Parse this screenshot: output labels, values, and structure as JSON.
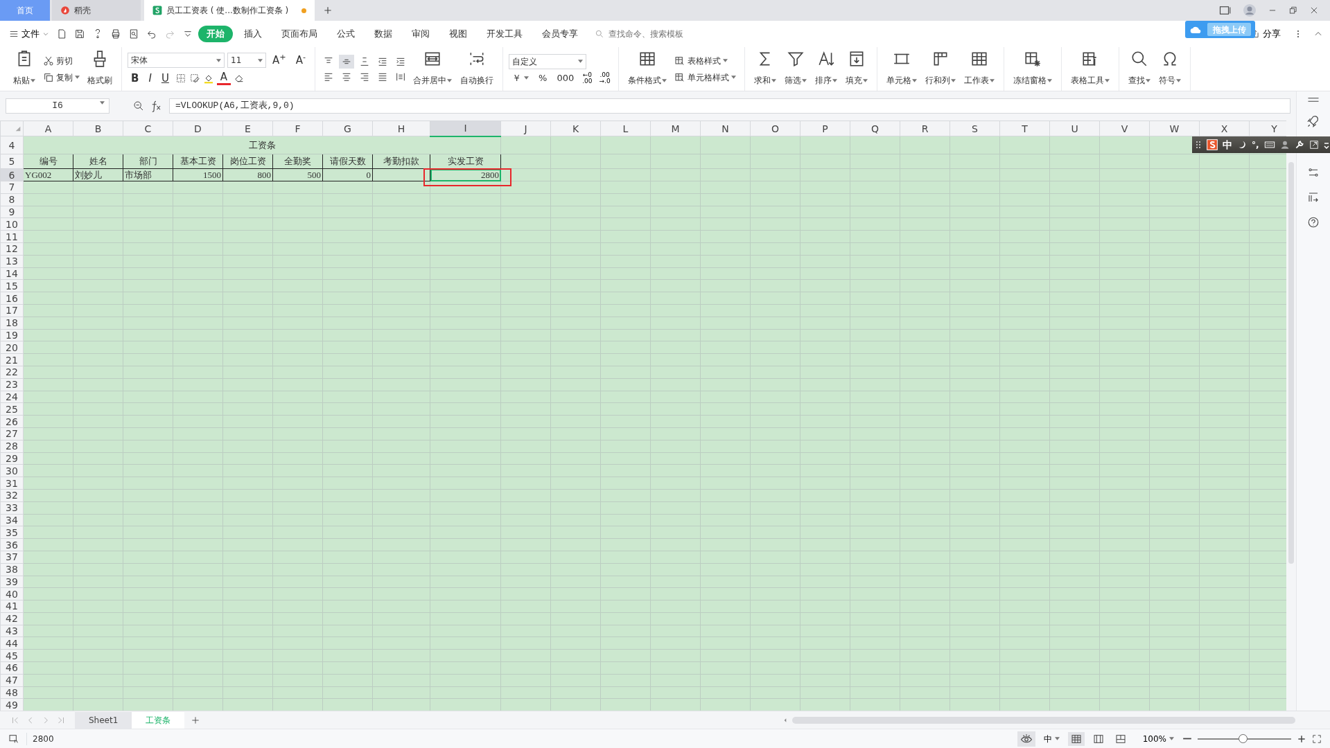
{
  "title_tabs": [
    {
      "label": "首页",
      "kind": "home",
      "selected": false,
      "modified": false
    },
    {
      "label": "稻壳",
      "kind": "app",
      "selected": false,
      "modified": false
    },
    {
      "label": "员工工资表 ( 使...数制作工资条 )",
      "kind": "doc",
      "selected": true,
      "modified": true
    }
  ],
  "file_menu": "文件",
  "menu_tabs": [
    {
      "label": "开始",
      "selected": true
    },
    {
      "label": "插入",
      "selected": false
    },
    {
      "label": "页面布局",
      "selected": false
    },
    {
      "label": "公式",
      "selected": false
    },
    {
      "label": "数据",
      "selected": false
    },
    {
      "label": "审阅",
      "selected": false
    },
    {
      "label": "视图",
      "selected": false
    },
    {
      "label": "开发工具",
      "selected": false
    },
    {
      "label": "会员专享",
      "selected": false
    }
  ],
  "search": {
    "placeholder": "查找命令、搜索模板"
  },
  "upload_popup": "拖拽上传",
  "share": "分享",
  "ribbon": {
    "clipboard": [
      {
        "label": "粘贴",
        "kind": "large",
        "dropdown": true
      },
      {
        "label": "剪切",
        "kind": "small",
        "dropdown": false
      },
      {
        "label": "复制",
        "kind": "small",
        "dropdown": true
      },
      {
        "label": "格式刷",
        "kind": "large",
        "dropdown": false
      }
    ],
    "font": {
      "name": "宋体",
      "size": "11",
      "size_buttons": [
        "A$^{+}$",
        "A$^{-}$"
      ],
      "style_buttons": [
        "B",
        "I",
        "U"
      ],
      "color_button": "A"
    },
    "alignment": [
      {
        "label": "合并居中",
        "dropdown": true
      },
      {
        "label": "自动换行",
        "dropdown": false
      }
    ],
    "number": {
      "format": "自定义",
      "symbols": [
        "￥",
        "%",
        "000"
      ],
      "decimal_buttons": [
        {
          "top": "←0",
          "bottom": ".00"
        },
        {
          "top": ".00",
          "bottom": "→.0"
        }
      ]
    },
    "styles": [
      {
        "label": "条件格式",
        "kind": "large",
        "dropdown": true
      },
      {
        "label": "表格样式",
        "kind": "small",
        "dropdown": true
      },
      {
        "label": "单元格样式",
        "kind": "small",
        "dropdown": true
      }
    ],
    "groups": [
      [
        {
          "label": "求和",
          "dropdown": true
        },
        {
          "label": "筛选",
          "dropdown": true
        },
        {
          "label": "排序",
          "dropdown": true
        },
        {
          "label": "填充",
          "dropdown": true
        }
      ],
      [
        {
          "label": "单元格",
          "dropdown": true
        },
        {
          "label": "行和列",
          "dropdown": true
        },
        {
          "label": "工作表",
          "dropdown": true
        }
      ],
      [
        {
          "label": "冻结窗格",
          "dropdown": true
        }
      ],
      [
        {
          "label": "表格工具",
          "dropdown": true
        }
      ],
      [
        {
          "label": "查找",
          "dropdown": true
        },
        {
          "label": "符号",
          "dropdown": true
        }
      ]
    ]
  },
  "name_box": "I6",
  "formula": "=VLOOKUP(A6,工资表,9,0)",
  "columns": [
    {
      "label": "A",
      "selected": false
    },
    {
      "label": "B",
      "selected": false
    },
    {
      "label": "C",
      "selected": false
    },
    {
      "label": "D",
      "selected": false
    },
    {
      "label": "E",
      "selected": false
    },
    {
      "label": "F",
      "selected": false
    },
    {
      "label": "G",
      "selected": false
    },
    {
      "label": "H",
      "selected": false
    },
    {
      "label": "I",
      "selected": true
    },
    {
      "label": "J",
      "selected": false
    },
    {
      "label": "K",
      "selected": false
    },
    {
      "label": "L",
      "selected": false
    },
    {
      "label": "M",
      "selected": false
    },
    {
      "label": "N",
      "selected": false
    },
    {
      "label": "O",
      "selected": false
    },
    {
      "label": "P",
      "selected": false
    },
    {
      "label": "Q",
      "selected": false
    },
    {
      "label": "R",
      "selected": false
    },
    {
      "label": "S",
      "selected": false
    },
    {
      "label": "T",
      "selected": false
    },
    {
      "label": "U",
      "selected": false
    },
    {
      "label": "V",
      "selected": false
    },
    {
      "label": "W",
      "selected": false
    },
    {
      "label": "X",
      "selected": false
    },
    {
      "label": "Y",
      "selected": false
    }
  ],
  "rows": [
    {
      "label": "4",
      "selected": false,
      "cells": [
        {
          "text": "工资条",
          "kind": "title",
          "selected": false,
          "annotated": false
        }
      ]
    },
    {
      "label": "5",
      "selected": false,
      "cells": [
        {
          "text": "编号",
          "kind": "header",
          "selected": false,
          "annotated": false
        },
        {
          "text": "姓名",
          "kind": "header",
          "selected": false,
          "annotated": false
        },
        {
          "text": "部门",
          "kind": "header",
          "selected": false,
          "annotated": false
        },
        {
          "text": "基本工资",
          "kind": "header",
          "selected": false,
          "annotated": false
        },
        {
          "text": "岗位工资",
          "kind": "header",
          "selected": false,
          "annotated": false
        },
        {
          "text": "全勤奖",
          "kind": "header",
          "selected": false,
          "annotated": false
        },
        {
          "text": "请假天数",
          "kind": "header",
          "selected": false,
          "annotated": false
        },
        {
          "text": "考勤扣款",
          "kind": "header",
          "selected": false,
          "annotated": false
        },
        {
          "text": "实发工资",
          "kind": "header",
          "selected": false,
          "annotated": false
        }
      ]
    },
    {
      "label": "6",
      "selected": true,
      "cells": [
        {
          "text": "YG002",
          "kind": "text",
          "selected": false,
          "annotated": false
        },
        {
          "text": "刘妙儿",
          "kind": "text",
          "selected": false,
          "annotated": false
        },
        {
          "text": "市场部",
          "kind": "text",
          "selected": false,
          "annotated": false
        },
        {
          "text": "1500",
          "kind": "number",
          "selected": false,
          "annotated": false
        },
        {
          "text": "800",
          "kind": "number",
          "selected": false,
          "annotated": false
        },
        {
          "text": "500",
          "kind": "number",
          "selected": false,
          "annotated": false
        },
        {
          "text": "0",
          "kind": "number",
          "selected": false,
          "annotated": false
        },
        {
          "kind": "number",
          "selected": false,
          "annotated": false
        },
        {
          "text": "2800",
          "kind": "number",
          "selected": true,
          "annotated": true
        }
      ]
    },
    {
      "label": "7",
      "selected": false
    },
    {
      "label": "8",
      "selected": false
    },
    {
      "label": "9",
      "selected": false
    },
    {
      "label": "10",
      "selected": false
    },
    {
      "label": "11",
      "selected": false
    },
    {
      "label": "12",
      "selected": false
    },
    {
      "label": "13",
      "selected": false
    },
    {
      "label": "14",
      "selected": false
    },
    {
      "label": "15",
      "selected": false
    },
    {
      "label": "16",
      "selected": false
    },
    {
      "label": "17",
      "selected": false
    },
    {
      "label": "18",
      "selected": false
    },
    {
      "label": "19",
      "selected": false
    },
    {
      "label": "20",
      "selected": false
    },
    {
      "label": "21",
      "selected": false
    },
    {
      "label": "22",
      "selected": false
    },
    {
      "label": "23",
      "selected": false
    },
    {
      "label": "24",
      "selected": false
    },
    {
      "label": "25",
      "selected": false
    },
    {
      "label": "26",
      "selected": false
    },
    {
      "label": "27",
      "selected": false
    },
    {
      "label": "28",
      "selected": false
    },
    {
      "label": "29",
      "selected": false
    },
    {
      "label": "30",
      "selected": false
    },
    {
      "label": "31",
      "selected": false
    },
    {
      "label": "32",
      "selected": false
    },
    {
      "label": "33",
      "selected": false
    },
    {
      "label": "34",
      "selected": false
    },
    {
      "label": "35",
      "selected": false
    },
    {
      "label": "36",
      "selected": false
    },
    {
      "label": "37",
      "selected": false
    },
    {
      "label": "38",
      "selected": false
    },
    {
      "label": "39",
      "selected": false
    },
    {
      "label": "40",
      "selected": false
    },
    {
      "label": "41",
      "selected": false
    },
    {
      "label": "42",
      "selected": false
    },
    {
      "label": "43",
      "selected": false
    },
    {
      "label": "44",
      "selected": false
    },
    {
      "label": "45",
      "selected": false
    },
    {
      "label": "46",
      "selected": false
    },
    {
      "label": "47",
      "selected": false
    },
    {
      "label": "48",
      "selected": false
    },
    {
      "label": "49",
      "selected": false
    }
  ],
  "sheet_tabs": [
    {
      "label": "Sheet1",
      "selected": false
    },
    {
      "label": "工资条",
      "selected": true
    }
  ],
  "ime_bar": {
    "mode": "中",
    "punctuation": "°,"
  },
  "status_bar": {
    "value": "2800",
    "input_mode": "中",
    "view_modes": [
      {
        "selected": true
      },
      {
        "selected": false
      },
      {
        "selected": false
      }
    ],
    "zoom": "100%",
    "zoom_slider": {
      "level": 0.48
    }
  }
}
